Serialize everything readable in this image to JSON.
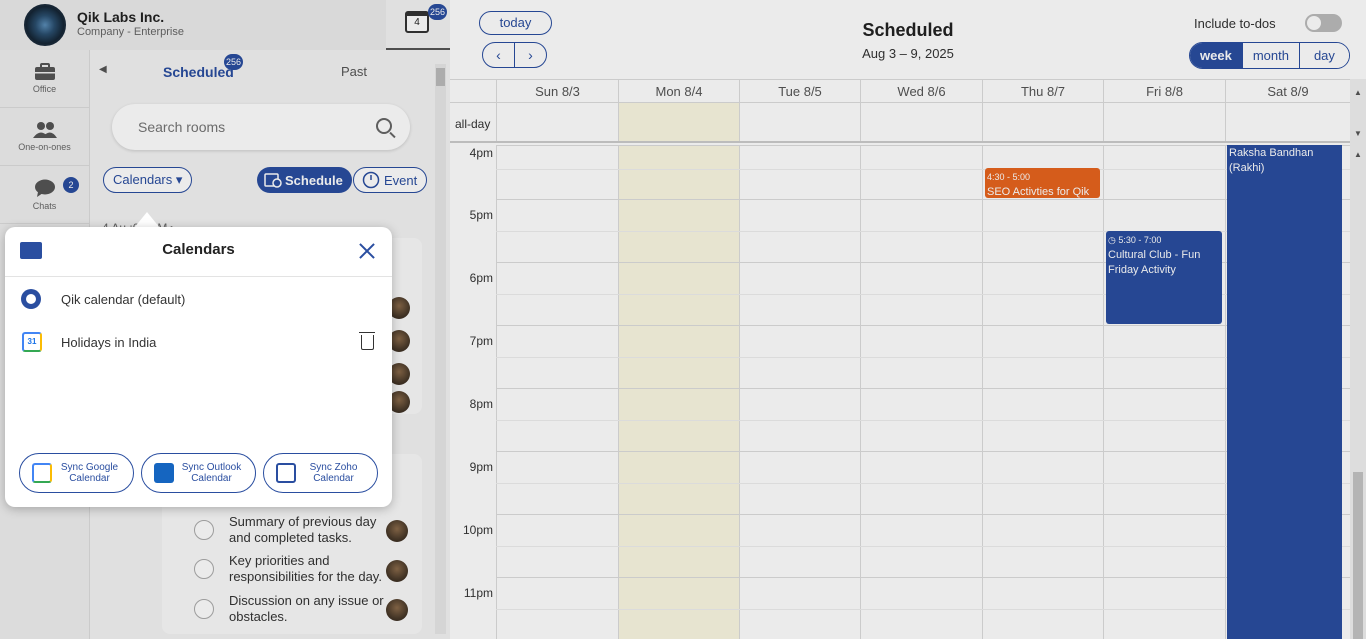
{
  "company": {
    "name": "Qik Labs Inc.",
    "plan": "Company - Enterprise"
  },
  "top_calendar": {
    "day": "4",
    "badge": "256"
  },
  "nav": [
    {
      "label": "Office",
      "icon": "briefcase-icon"
    },
    {
      "label": "One-on-ones",
      "icon": "people-icon"
    },
    {
      "label": "Chats",
      "icon": "chat-icon",
      "badge": "2"
    }
  ],
  "panel": {
    "back_arrow": "◀",
    "tab_scheduled": "Scheduled",
    "tab_scheduled_badge": "256",
    "tab_past": "Past",
    "search_placeholder": "Search rooms",
    "calendars_btn": "Calendars ▾",
    "schedule_btn": "Schedule",
    "event_btn": "Event",
    "partial_date": "4 Au     :00 PM ▸",
    "tasks": [
      "Summary of previous day and completed tasks.",
      "Key priorities and responsibilities for the day.",
      "Discussion on any issue or obstacles."
    ]
  },
  "popup": {
    "title": "Calendars",
    "calendars": [
      {
        "name": "Qik calendar (default)",
        "icon": "qik-icon"
      },
      {
        "name": "Holidays in India",
        "icon": "google-calendar-icon",
        "google_day": "31"
      }
    ],
    "sync": [
      {
        "label": "Sync Google Calendar"
      },
      {
        "label": "Sync Outlook Calendar"
      },
      {
        "label": "Sync Zoho Calendar"
      }
    ]
  },
  "calendar": {
    "today_btn": "today",
    "prev": "‹",
    "next": "›",
    "title": "Scheduled",
    "range": "Aug 3 – 9, 2025",
    "include_todos": "Include to-dos",
    "views": [
      "week",
      "month",
      "day"
    ],
    "active_view": "week",
    "days": [
      "Sun 8/3",
      "Mon 8/4",
      "Tue 8/5",
      "Wed 8/6",
      "Thu 8/7",
      "Fri 8/8",
      "Sat 8/9"
    ],
    "allday_label": "all-day",
    "hours": [
      "4pm",
      "5pm",
      "6pm",
      "7pm",
      "8pm",
      "9pm",
      "10pm",
      "11pm"
    ],
    "events": [
      {
        "time": "4:30 - 5:00",
        "title": "SEO Activties for Qik",
        "color": "#e8641e"
      },
      {
        "time": "5:30 - 7:00",
        "title": "Cultural Club - Fun Friday Activity",
        "color": "#2a4ea0"
      },
      {
        "time": "",
        "title": "Raksha Bandhan (Rakhi)",
        "color": "#2a4ea0"
      }
    ]
  },
  "colors": {
    "accent": "#2a4ea0",
    "orange": "#e8641e",
    "today_bg": "#fbf8e2"
  }
}
